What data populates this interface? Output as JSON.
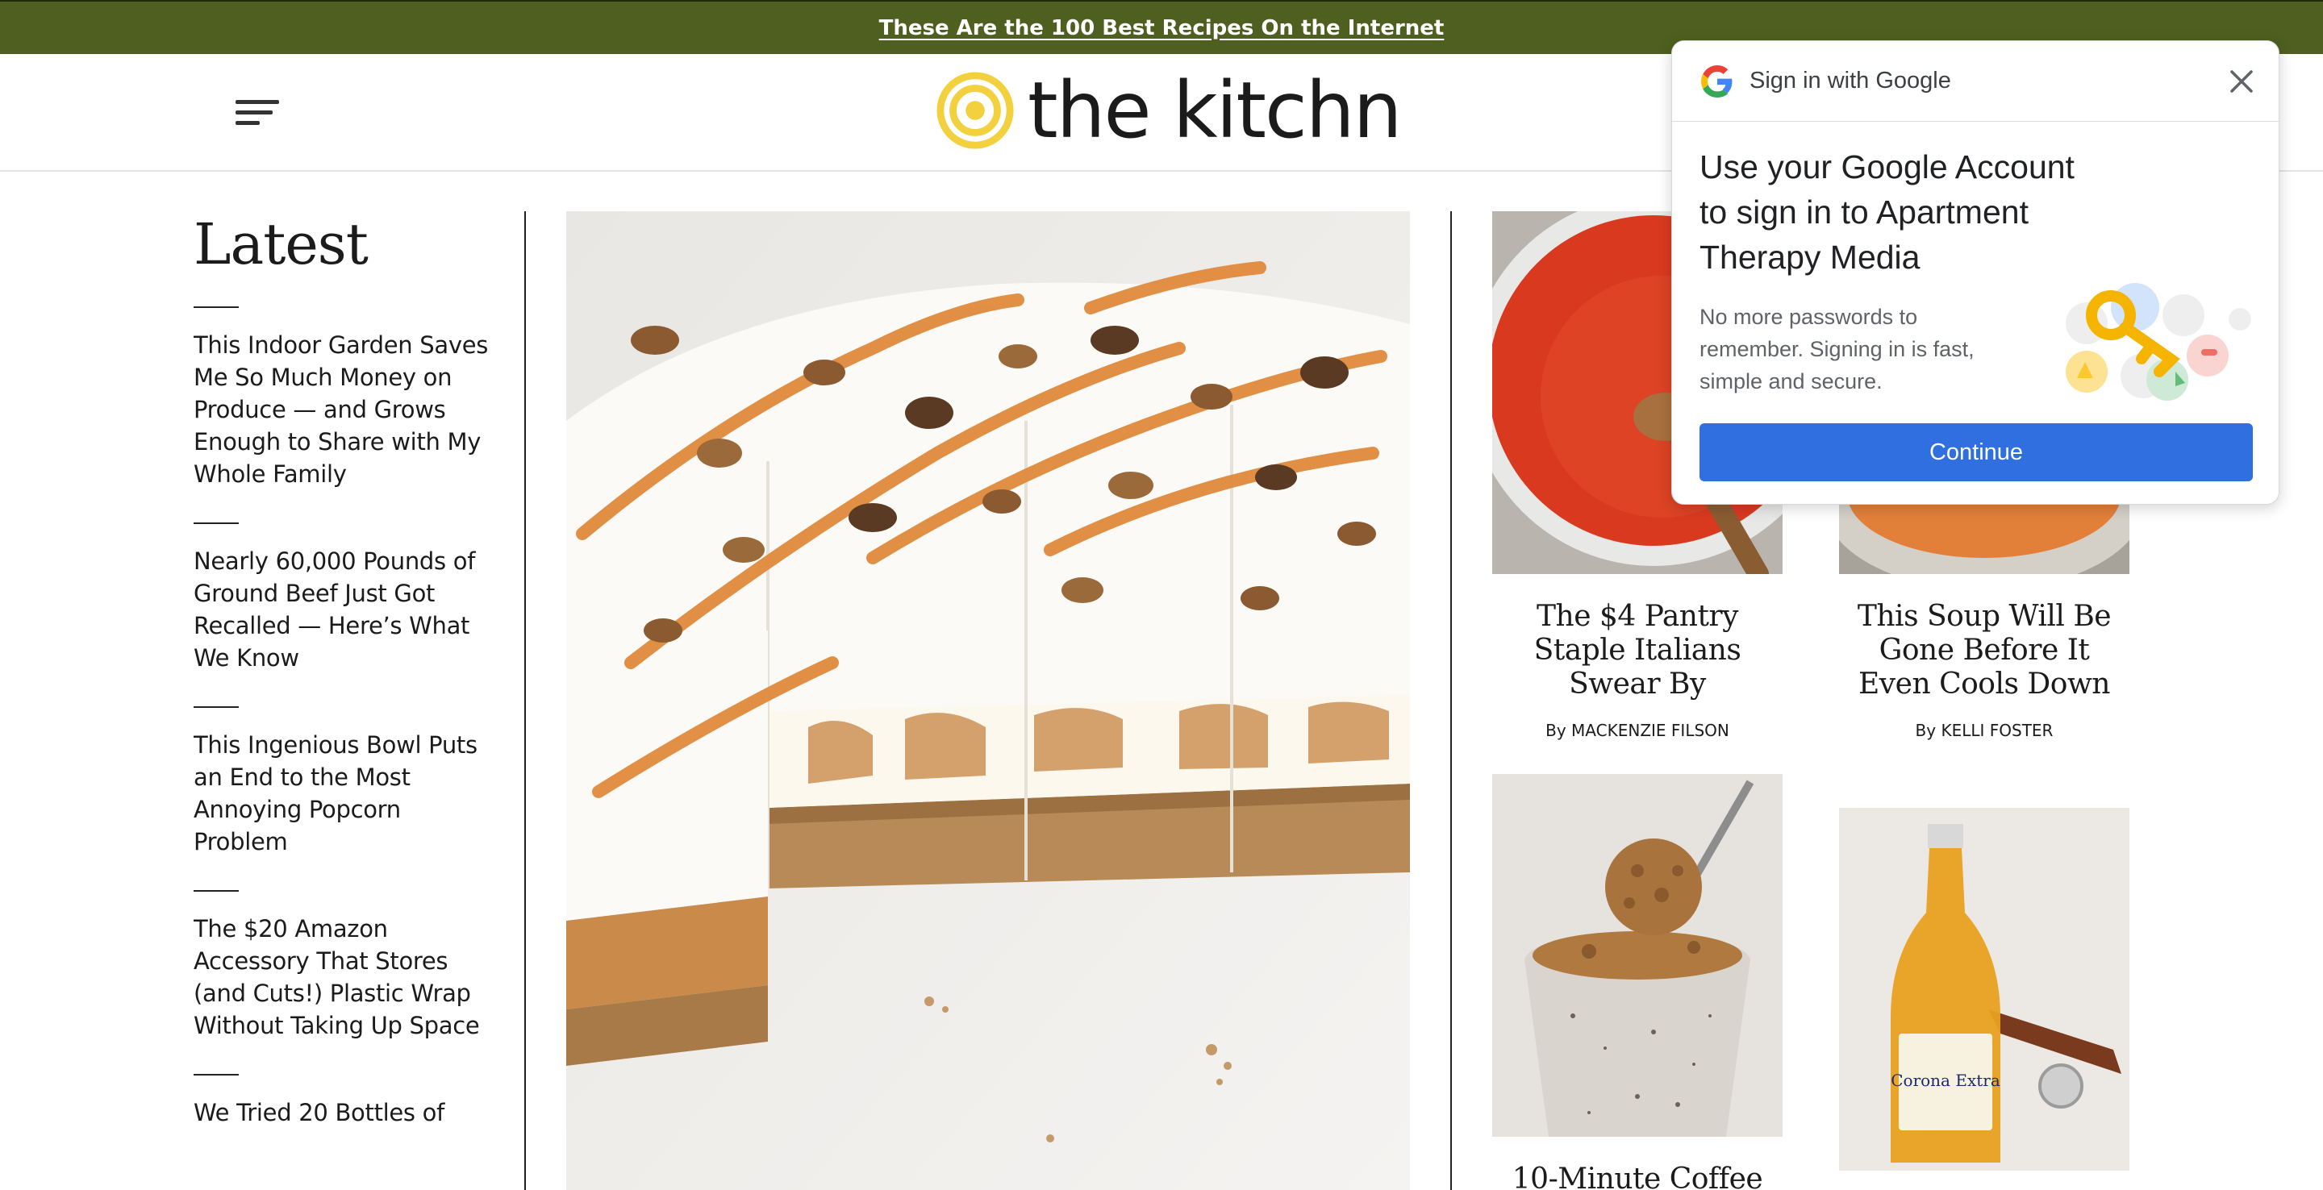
{
  "promo": {
    "text": "These Are the 100 Best Recipes On the Internet"
  },
  "header": {
    "logo_text": "the kitchn"
  },
  "latest": {
    "heading": "Latest",
    "items": [
      "This Indoor Garden Saves Me So Much Money on Produce — and Grows Enough to Share with My Whole Family",
      "Nearly 60,000 Pounds of Ground Beef Just Got Recalled — Here’s What We Know",
      "This Ingenious Bowl Puts an End to the Most Annoying Popcorn Problem",
      "The $20 Amazon Accessory That Stores (and Cuts!) Plastic Wrap Without Taking Up Space",
      "We Tried 20 Bottles of"
    ]
  },
  "cards": [
    {
      "title": "The $4 Pantry Staple Italians Swear By",
      "byline": "By MACKENZIE FILSON"
    },
    {
      "title": "This Soup Will Be Gone Before It Even Cools Down",
      "byline": "By KELLI FOSTER"
    },
    {
      "title": "10-Minute Coffee"
    }
  ],
  "beer_label": "Corona Extra",
  "google_popup": {
    "header": "Sign in with Google",
    "title": "Use your Google Account to sign in to Apartment Therapy Media",
    "body": "No more passwords to remember. Signing in is fast, simple and secure.",
    "button": "Continue"
  },
  "colors": {
    "promo_bg": "#4f5f20",
    "logo_yellow": "#f3d03e",
    "google_button": "#2f6fe0"
  },
  "icons": [
    "menu-icon",
    "kitchn-spiral-logo",
    "google-g-icon",
    "close-icon",
    "key-icon"
  ]
}
